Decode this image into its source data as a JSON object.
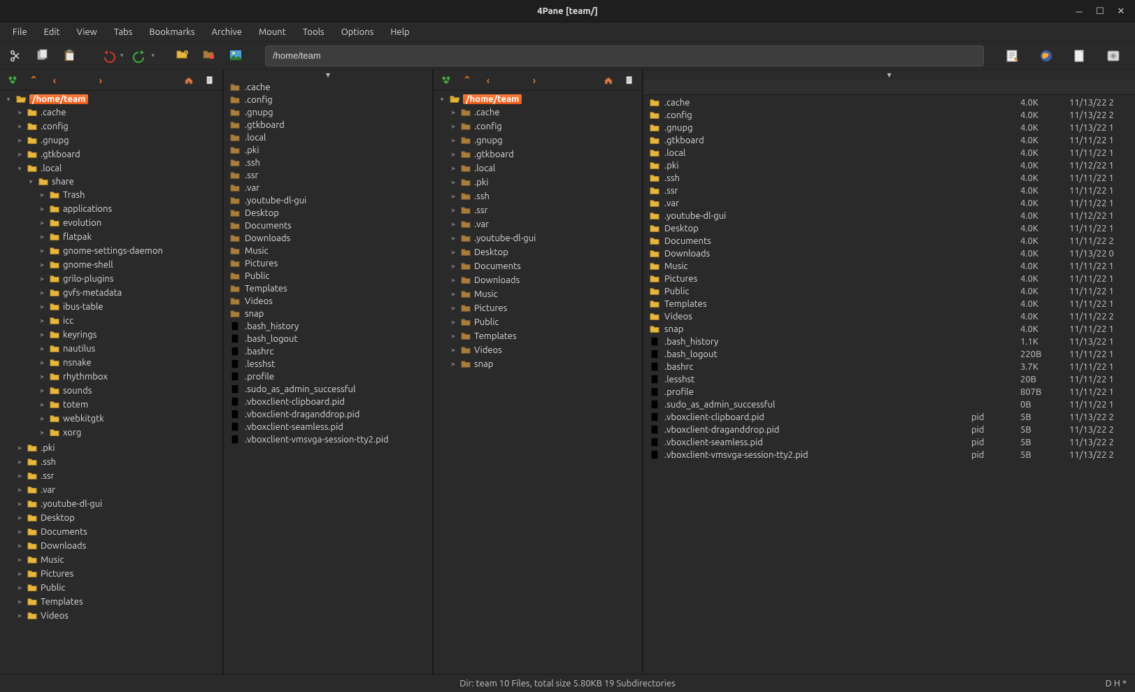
{
  "title": "4Pane [team/]",
  "menu": [
    "File",
    "Edit",
    "View",
    "Tabs",
    "Bookmarks",
    "Archive",
    "Mount",
    "Tools",
    "Options",
    "Help"
  ],
  "path": "/home/team",
  "tree1": {
    "root": "/home/team",
    "level1": [
      {
        "name": ".cache",
        "expand": false
      },
      {
        "name": ".config",
        "expand": false
      },
      {
        "name": ".gnupg",
        "expand": false
      },
      {
        "name": ".gtkboard",
        "expand": false
      },
      {
        "name": ".local",
        "expand": true,
        "children": [
          {
            "name": "share",
            "expand": true,
            "children": [
              "Trash",
              "applications",
              "evolution",
              "flatpak",
              "gnome-settings-daemon",
              "gnome-shell",
              "grilo-plugins",
              "gvfs-metadata",
              "ibus-table",
              "icc",
              "keyrings",
              "nautilus",
              "nsnake",
              "rhythmbox",
              "sounds",
              "totem",
              "webkitgtk",
              "xorg"
            ]
          }
        ]
      },
      {
        "name": ".pki",
        "expand": false
      },
      {
        "name": ".ssh",
        "expand": false
      },
      {
        "name": ".ssr",
        "expand": false
      },
      {
        "name": ".var",
        "expand": false
      },
      {
        "name": ".youtube-dl-gui",
        "expand": false
      },
      {
        "name": "Desktop",
        "expand": false
      },
      {
        "name": "Documents",
        "expand": false
      },
      {
        "name": "Downloads",
        "expand": false
      },
      {
        "name": "Music",
        "expand": false
      },
      {
        "name": "Pictures",
        "expand": false
      },
      {
        "name": "Public",
        "expand": false
      },
      {
        "name": "Templates",
        "expand": false
      },
      {
        "name": "Videos",
        "expand": false
      }
    ]
  },
  "tree2": {
    "root": "/home/team",
    "folders": [
      ".cache",
      ".config",
      ".gnupg",
      ".gtkboard",
      ".local",
      ".pki",
      ".ssh",
      ".ssr",
      ".var",
      ".youtube-dl-gui",
      "Desktop",
      "Documents",
      "Downloads",
      "Music",
      "Pictures",
      "Public",
      "Templates",
      "Videos",
      "snap"
    ]
  },
  "list1": {
    "folders": [
      ".cache",
      ".config",
      ".gnupg",
      ".gtkboard",
      ".local",
      ".pki",
      ".ssh",
      ".ssr",
      ".var",
      ".youtube-dl-gui",
      "Desktop",
      "Documents",
      "Downloads",
      "Music",
      "Pictures",
      "Public",
      "Templates",
      "Videos",
      "snap"
    ],
    "files": [
      ".bash_history",
      ".bash_logout",
      ".bashrc",
      ".lesshst",
      ".profile",
      ".sudo_as_admin_successful",
      ".vboxclient-clipboard.pid",
      ".vboxclient-draganddrop.pid",
      ".vboxclient-seamless.pid",
      ".vboxclient-vmsvga-session-tty2.pid"
    ]
  },
  "list2": [
    {
      "name": ".cache",
      "type": "d",
      "size": "4.0K",
      "date": "11/13/22 2"
    },
    {
      "name": ".config",
      "type": "d",
      "size": "4.0K",
      "date": "11/13/22 2"
    },
    {
      "name": ".gnupg",
      "type": "d",
      "size": "4.0K",
      "date": "11/13/22 1"
    },
    {
      "name": ".gtkboard",
      "type": "d",
      "size": "4.0K",
      "date": "11/11/22 1"
    },
    {
      "name": ".local",
      "type": "d",
      "size": "4.0K",
      "date": "11/11/22 1"
    },
    {
      "name": ".pki",
      "type": "d",
      "size": "4.0K",
      "date": "11/12/22 1"
    },
    {
      "name": ".ssh",
      "type": "d",
      "size": "4.0K",
      "date": "11/11/22 1"
    },
    {
      "name": ".ssr",
      "type": "d",
      "size": "4.0K",
      "date": "11/11/22 1"
    },
    {
      "name": ".var",
      "type": "d",
      "size": "4.0K",
      "date": "11/11/22 1"
    },
    {
      "name": ".youtube-dl-gui",
      "type": "d",
      "size": "4.0K",
      "date": "11/12/22 1"
    },
    {
      "name": "Desktop",
      "type": "d",
      "size": "4.0K",
      "date": "11/11/22 1"
    },
    {
      "name": "Documents",
      "type": "d",
      "size": "4.0K",
      "date": "11/11/22 2"
    },
    {
      "name": "Downloads",
      "type": "d",
      "size": "4.0K",
      "date": "11/13/22 0"
    },
    {
      "name": "Music",
      "type": "d",
      "size": "4.0K",
      "date": "11/11/22 1"
    },
    {
      "name": "Pictures",
      "type": "d",
      "size": "4.0K",
      "date": "11/11/22 1"
    },
    {
      "name": "Public",
      "type": "d",
      "size": "4.0K",
      "date": "11/11/22 1"
    },
    {
      "name": "Templates",
      "type": "d",
      "size": "4.0K",
      "date": "11/11/22 1"
    },
    {
      "name": "Videos",
      "type": "d",
      "size": "4.0K",
      "date": "11/11/22 2"
    },
    {
      "name": "snap",
      "type": "d",
      "size": "4.0K",
      "date": "11/11/22 1"
    },
    {
      "name": ".bash_history",
      "type": "f",
      "ext": "",
      "size": "1.1K",
      "date": "11/13/22 1"
    },
    {
      "name": ".bash_logout",
      "type": "f",
      "ext": "",
      "size": "220B",
      "date": "11/11/22 1"
    },
    {
      "name": ".bashrc",
      "type": "f",
      "ext": "",
      "size": "3.7K",
      "date": "11/11/22 1"
    },
    {
      "name": ".lesshst",
      "type": "f",
      "ext": "",
      "size": "20B",
      "date": "11/11/22 1"
    },
    {
      "name": ".profile",
      "type": "f",
      "ext": "",
      "size": "807B",
      "date": "11/11/22 1"
    },
    {
      "name": ".sudo_as_admin_successful",
      "type": "f",
      "ext": "",
      "size": "0B",
      "date": "11/11/22 1"
    },
    {
      "name": ".vboxclient-clipboard.pid",
      "type": "f",
      "ext": "pid",
      "size": "5B",
      "date": "11/13/22 2"
    },
    {
      "name": ".vboxclient-draganddrop.pid",
      "type": "f",
      "ext": "pid",
      "size": "5B",
      "date": "11/13/22 2"
    },
    {
      "name": ".vboxclient-seamless.pid",
      "type": "f",
      "ext": "pid",
      "size": "5B",
      "date": "11/13/22 2"
    },
    {
      "name": ".vboxclient-vmsvga-session-tty2.pid",
      "type": "f",
      "ext": "pid",
      "size": "5B",
      "date": "11/13/22 2"
    }
  ],
  "status": {
    "center": "Dir: team   10 Files, total size 5.80KB   19 Subdirectories",
    "right": "D H   *"
  }
}
